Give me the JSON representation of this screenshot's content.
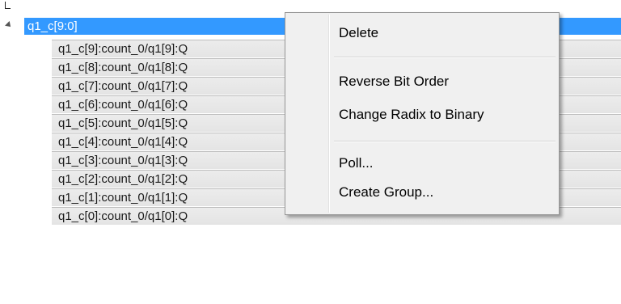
{
  "tree": {
    "group_label": "q1_c[9:0]",
    "signals": [
      "q1_c[9]:count_0/q1[9]:Q",
      "q1_c[8]:count_0/q1[8]:Q",
      "q1_c[7]:count_0/q1[7]:Q",
      "q1_c[6]:count_0/q1[6]:Q",
      "q1_c[5]:count_0/q1[5]:Q",
      "q1_c[4]:count_0/q1[4]:Q",
      "q1_c[3]:count_0/q1[3]:Q",
      "q1_c[2]:count_0/q1[2]:Q",
      "q1_c[1]:count_0/q1[1]:Q",
      "q1_c[0]:count_0/q1[0]:Q"
    ]
  },
  "context_menu": {
    "delete": "Delete",
    "reverse_bit_order": "Reverse Bit Order",
    "change_radix": "Change Radix to Binary",
    "poll": "Poll...",
    "create_group": "Create Group..."
  },
  "colors": {
    "selection": "#3399ff",
    "menu_background": "#f0f0f0",
    "row_background": "#e8e8e8"
  }
}
